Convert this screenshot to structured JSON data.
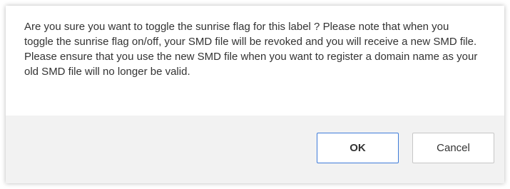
{
  "dialog": {
    "message": "Are you sure you want to toggle the sunrise flag for this label ? Please note that when you toggle the sunrise flag on/off, your SMD file will be revoked and you will receive a new SMD file. Please ensure that you use the new SMD file when you want to register a domain name as your old SMD file will no longer be valid.",
    "ok_label": "OK",
    "cancel_label": "Cancel"
  },
  "colors": {
    "footer_background": "#f2f2f2",
    "ok_border": "#3e7bd9",
    "cancel_border": "#c6c6c6",
    "text": "#333333"
  }
}
